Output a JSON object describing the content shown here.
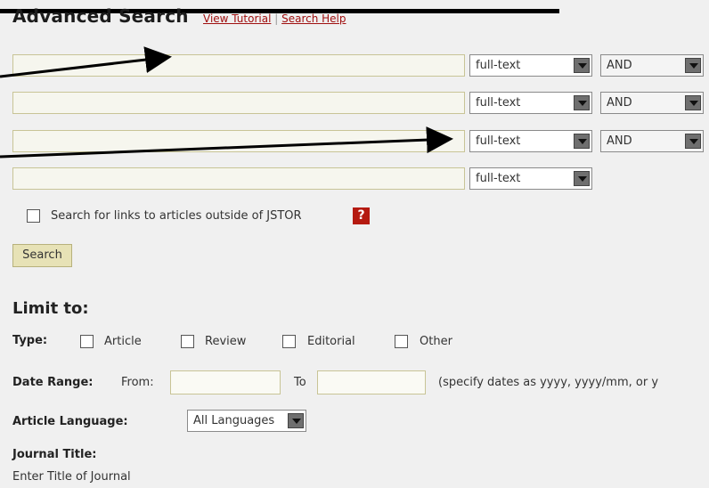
{
  "header": {
    "title": "Advanced Search",
    "view_tutorial": "View Tutorial",
    "separator": "|",
    "search_help": "Search Help"
  },
  "query_rows": [
    {
      "field": "full-text",
      "operator": "AND",
      "value": ""
    },
    {
      "field": "full-text",
      "operator": "AND",
      "value": ""
    },
    {
      "field": "full-text",
      "operator": "AND",
      "value": ""
    },
    {
      "field": "full-text",
      "value": ""
    }
  ],
  "outside_links": {
    "label": "Search for links to articles outside of JSTOR",
    "help_glyph": "?",
    "checked": false
  },
  "search_button": "Search",
  "limit": {
    "heading": "Limit to:",
    "type_label": "Type:",
    "types": [
      "Article",
      "Review",
      "Editorial",
      "Other"
    ],
    "date_range_label": "Date Range:",
    "from_label": "From:",
    "to_label": "To",
    "date_hint": "(specify dates as yyyy, yyyy/mm, or y",
    "language_label": "Article Language:",
    "language_value": "All Languages",
    "journal_title_label": "Journal Title:",
    "journal_title_hint": "Enter Title of Journal"
  },
  "colors": {
    "link": "#a01010",
    "help_badge": "#b51a10",
    "input_border": "#c8c496",
    "search_button_bg": "#e7e2b6"
  }
}
